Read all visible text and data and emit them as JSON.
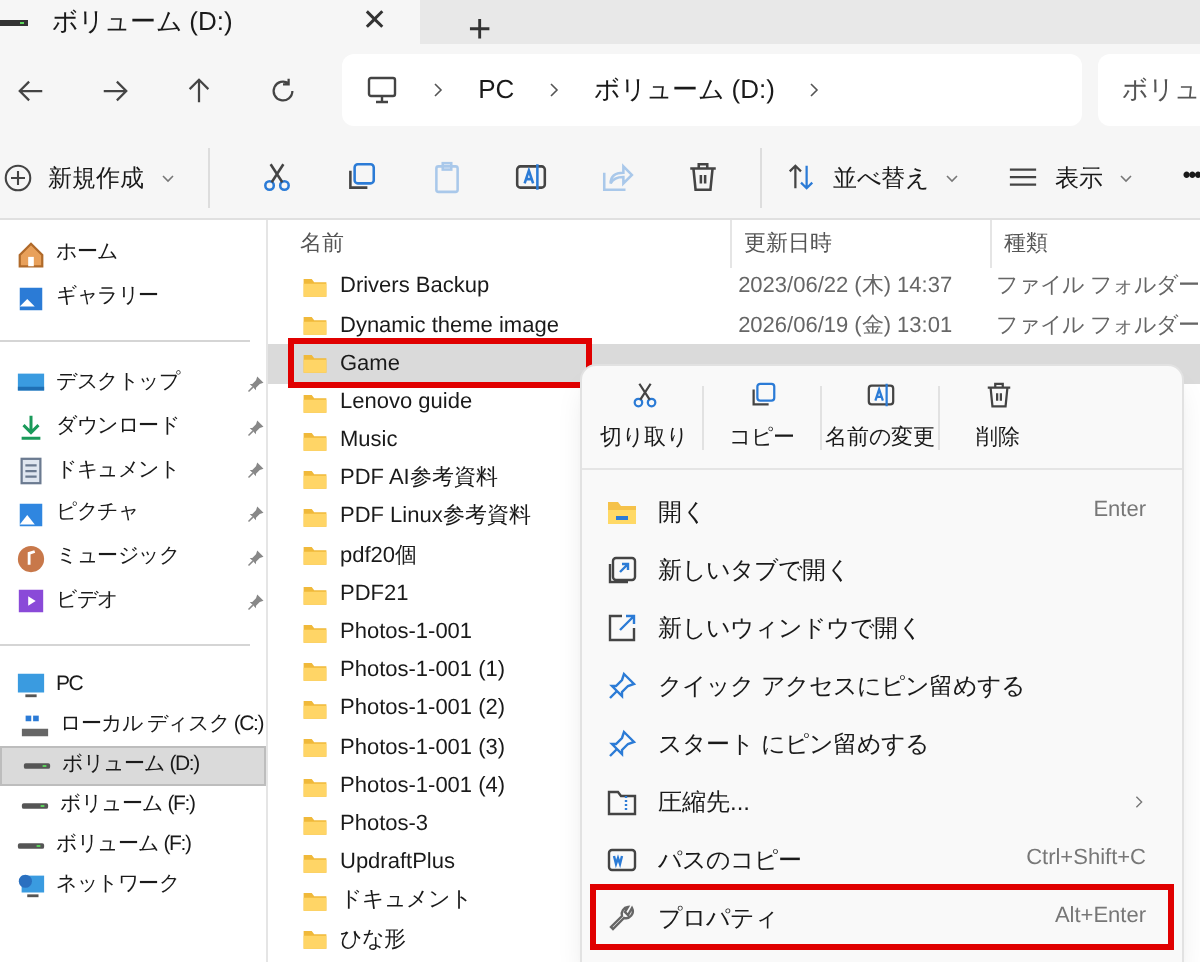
{
  "tab": {
    "title": "ボリューム (D:)",
    "close": "✕",
    "new": "+"
  },
  "address": {
    "crumbs": [
      "PC",
      "ボリューム (D:)"
    ],
    "search": "ボリュ"
  },
  "toolbar": {
    "new": "新規作成",
    "sort": "並べ替え",
    "view": "表示",
    "more": "•••"
  },
  "sidebar": {
    "quick": [
      {
        "label": "ホーム",
        "kind": "home"
      },
      {
        "label": "ギャラリー",
        "kind": "gallery"
      }
    ],
    "pinned": [
      {
        "label": "デスクトップ",
        "kind": "desktop",
        "pinned": true
      },
      {
        "label": "ダウンロード",
        "kind": "download",
        "pinned": true
      },
      {
        "label": "ドキュメント",
        "kind": "document",
        "pinned": true
      },
      {
        "label": "ピクチャ",
        "kind": "picture",
        "pinned": true
      },
      {
        "label": "ミュージック",
        "kind": "music",
        "pinned": true
      },
      {
        "label": "ビデオ",
        "kind": "video",
        "pinned": true
      }
    ],
    "drives": [
      {
        "label": "PC",
        "kind": "pc",
        "selected": false,
        "children": [
          {
            "label": "ローカル ディスク (C:)",
            "kind": "disk",
            "selected": false
          },
          {
            "label": "ボリューム (D:)",
            "kind": "drive",
            "selected": true
          },
          {
            "label": "ボリューム (F:)",
            "kind": "drive",
            "selected": false
          }
        ]
      },
      {
        "label": "ボリューム (F:)",
        "kind": "drive",
        "selected": false
      },
      {
        "label": "ネットワーク",
        "kind": "network",
        "selected": false
      }
    ]
  },
  "table": {
    "columns": [
      "名前",
      "更新日時",
      "種類"
    ],
    "rows": [
      {
        "name": "Drivers Backup",
        "date": "2023/06/22 (木) 14:37",
        "type": "ファイル フォルダー",
        "selected": false
      },
      {
        "name": "Dynamic theme image",
        "date": "2026/06/19 (金) 13:01",
        "type": "ファイル フォルダー",
        "selected": false
      },
      {
        "name": "Game",
        "selected": true,
        "highlighted": true
      },
      {
        "name": "Lenovo guide",
        "selected": false
      },
      {
        "name": "Music",
        "selected": false
      },
      {
        "name": "PDF AI参考資料",
        "selected": false
      },
      {
        "name": "PDF Linux参考資料",
        "selected": false
      },
      {
        "name": "pdf20個",
        "selected": false
      },
      {
        "name": "PDF21",
        "selected": false
      },
      {
        "name": "Photos-1-001",
        "selected": false
      },
      {
        "name": "Photos-1-001 (1)",
        "selected": false
      },
      {
        "name": "Photos-1-001 (2)",
        "selected": false
      },
      {
        "name": "Photos-1-001 (3)",
        "selected": false
      },
      {
        "name": "Photos-1-001 (4)",
        "selected": false
      },
      {
        "name": "Photos-3",
        "selected": false
      },
      {
        "name": "UpdraftPlus",
        "selected": false
      },
      {
        "name": "ドキュメント",
        "selected": false
      },
      {
        "name": "ひな形",
        "selected": false
      }
    ]
  },
  "context_menu": {
    "actions": [
      {
        "label": "切り取り",
        "kind": "cut"
      },
      {
        "label": "コピー",
        "kind": "copy"
      },
      {
        "label": "名前の変更",
        "kind": "rename"
      },
      {
        "label": "削除",
        "kind": "delete"
      }
    ],
    "items": [
      {
        "label": "開く",
        "kind": "open",
        "shortcut": "Enter"
      },
      {
        "label": "新しいタブで開く",
        "kind": "newtab"
      },
      {
        "label": "新しいウィンドウで開く",
        "kind": "newwindow"
      },
      {
        "label": "クイック アクセスにピン留めする",
        "kind": "pin"
      },
      {
        "label": "スタート にピン留めする",
        "kind": "pin"
      },
      {
        "label": "圧縮先...",
        "kind": "zip",
        "submenu": true
      },
      {
        "label": "パスのコピー",
        "kind": "path",
        "shortcut": "Ctrl+Shift+C"
      },
      {
        "label": "プロパティ",
        "kind": "wrench",
        "shortcut": "Alt+Enter",
        "highlighted": true
      }
    ]
  }
}
